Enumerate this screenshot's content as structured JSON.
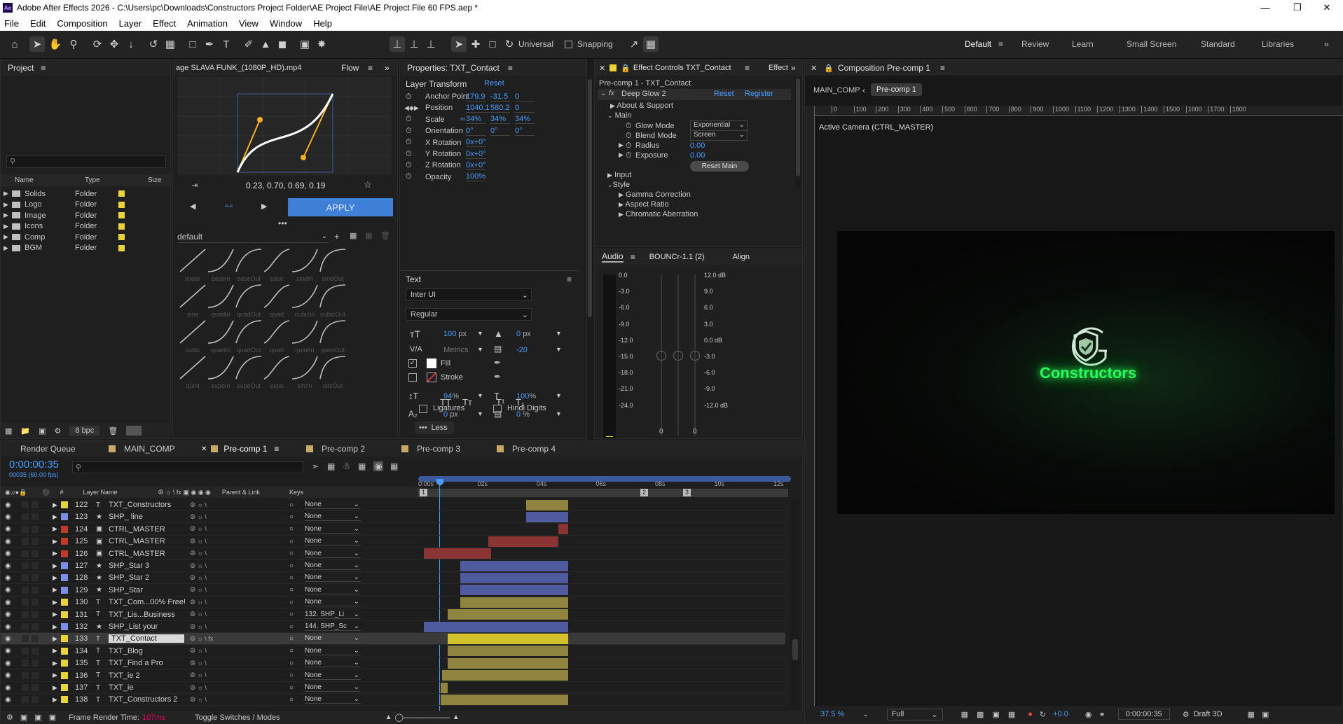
{
  "window": {
    "title": "Adobe After Effects 2026 - C:\\Users\\pc\\Downloads\\Constructors Project Folder\\AE Project File\\AE Project File 60 FPS.aep *",
    "app_icon": "Ae"
  },
  "menu": [
    "File",
    "Edit",
    "Composition",
    "Layer",
    "Effect",
    "Animation",
    "View",
    "Window",
    "Help"
  ],
  "toolbar": {
    "universal_label": "Universal",
    "snapping_label": "Snapping"
  },
  "workspaces": {
    "items": [
      "Default",
      "Review",
      "Learn",
      "Small Screen",
      "Standard",
      "Libraries"
    ],
    "active": "Default"
  },
  "project": {
    "title": "Project",
    "search_placeholder": "",
    "columns": {
      "name": "Name",
      "type": "Type",
      "size": "Size"
    },
    "items": [
      {
        "name": "Solids",
        "type": "Folder"
      },
      {
        "name": "Logo",
        "type": "Folder"
      },
      {
        "name": "Image",
        "type": "Folder"
      },
      {
        "name": "Icons",
        "type": "Folder"
      },
      {
        "name": "Comp",
        "type": "Folder"
      },
      {
        "name": "BGM",
        "type": "Folder"
      }
    ],
    "bpc": "8 bpc",
    "folder_color": "#e8d33b"
  },
  "flow": {
    "tab_label": "age SLAVA FUNK_(1080P_HD).mp4",
    "title": "Flow",
    "bezier": "0.23, 0.70, 0.69, 0.19",
    "apply": "APPLY",
    "preset": "default",
    "easings": [
      "linear",
      "easeIn",
      "easeOut",
      "ease",
      "sineIn",
      "sineOut",
      "sine",
      "quadIn",
      "quadOut",
      "quad",
      "cubicIn",
      "cubicOut",
      "cubic",
      "quartIn",
      "quartOut",
      "quart",
      "quintIn",
      "quintOut",
      "quint",
      "expoIn",
      "expoOut",
      "expo",
      "circIn",
      "circOut"
    ]
  },
  "properties": {
    "title": "Properties: TXT_Contact",
    "layer_transform": "Layer Transform",
    "reset": "Reset",
    "rows": [
      {
        "label": "Anchor Point",
        "values": [
          "179.9",
          "-31.5",
          "0"
        ]
      },
      {
        "label": "Position",
        "values": [
          "1040.1",
          "580.2",
          "0"
        ]
      },
      {
        "label": "Scale",
        "values": [
          "34%",
          "34%",
          "34%"
        ]
      },
      {
        "label": "Orientation",
        "values": [
          "0°",
          "0°",
          "0°"
        ]
      },
      {
        "label": "X Rotation",
        "values": [
          "0x+0°"
        ]
      },
      {
        "label": "Y Rotation",
        "values": [
          "0x+0°"
        ]
      },
      {
        "label": "Z Rotation",
        "values": [
          "0x+0°"
        ]
      },
      {
        "label": "Opacity",
        "values": [
          "100%"
        ]
      }
    ],
    "text": {
      "section": "Text",
      "font": "Inter UI",
      "style": "Regular",
      "size": "100",
      "size_unit": "px",
      "leading": "0",
      "leading_unit": "px",
      "kerning": "Metrics",
      "tracking": "-20",
      "fill": "Fill",
      "stroke": "Stroke",
      "vscale": "94",
      "hscale": "100",
      "baseline": "0",
      "baseline_unit": "px",
      "tsume": "0",
      "tsume_unit": "%",
      "pct": "%",
      "ligatures": "Ligatures",
      "hindi_digits": "Hindi Digits",
      "less": "Less"
    }
  },
  "effect_controls": {
    "title": "Effect Controls TXT_Contact",
    "tab2": "Effect",
    "breadcrumb": "Pre-comp 1 - TXT_Contact",
    "effect_name": "Deep Glow 2",
    "reset": "Reset",
    "register": "Register",
    "about": "About & Support",
    "main": "Main",
    "glow_mode_label": "Glow Mode",
    "glow_mode_value": "Exponential",
    "blend_mode_label": "Blend Mode",
    "blend_mode_value": "Screen",
    "radius_label": "Radius",
    "radius_value": "0.00",
    "exposure_label": "Exposure",
    "exposure_value": "0.00",
    "reset_main": "Reset Main",
    "input": "Input",
    "style": "Style",
    "gamma": "Gamma Correction",
    "aspect": "Aspect Ratio",
    "chromatic": "Chromatic Aberration"
  },
  "audio": {
    "tabs": [
      "Audio",
      "BOUNCr-1.1 (2)",
      "Align"
    ],
    "left_scale": [
      "0.0",
      "-3.0",
      "-6.0",
      "-9.0",
      "-12.0",
      "-15.0",
      "-18.0",
      "-21.0",
      "-24.0"
    ],
    "right_scale": [
      "12.0 dB",
      "9.0",
      "6.0",
      "3.0",
      "0.0 dB",
      "-3.0",
      "-6.0",
      "-9.0",
      "-12.0 dB"
    ],
    "bottom": [
      "0",
      "0"
    ]
  },
  "composition": {
    "title": "Composition Pre-comp 1",
    "breadcrumbs": [
      "MAIN_COMP",
      "Pre-comp 1"
    ],
    "ruler": [
      "0",
      "100",
      "200",
      "300",
      "400",
      "500",
      "600",
      "700",
      "800",
      "900",
      "1000",
      "1100",
      "1200",
      "1300",
      "1400",
      "1500",
      "1600",
      "1700",
      "1800"
    ],
    "camera": "Active Camera (CTRL_MASTER)",
    "logo_text": "Constructors",
    "glow_color": "#2bff5a",
    "zoom": "37.5 %",
    "quality": "Full",
    "exposure": "+0.0",
    "timecode": "0:00:00:35",
    "renderer": "Draft 3D"
  },
  "timeline": {
    "tabs": [
      "Render Queue",
      "MAIN_COMP",
      "Pre-comp 1",
      "Pre-comp 2",
      "Pre-comp 3",
      "Pre-comp 4"
    ],
    "active_tab": "Pre-comp 1",
    "timecode": "0:00:00:35",
    "frame_info": "00035 (60.00 fps)",
    "columns": {
      "layer_name": "Layer Name",
      "parent": "Parent & Link",
      "keys": "Keys",
      "num": "#"
    },
    "ruler": [
      "0:00s",
      "02s",
      "04s",
      "06s",
      "08s",
      "10s",
      "12s"
    ],
    "markers": [
      "1",
      "2",
      "3"
    ],
    "layers": [
      {
        "num": "122",
        "type": "T",
        "name": "TXT_Constructors",
        "parent": "None",
        "label": "#e8d33b"
      },
      {
        "num": "123",
        "type": "★",
        "name": "SHP_ line",
        "parent": "None",
        "label": "#7b8ee8"
      },
      {
        "num": "124",
        "type": "cam",
        "name": "CTRL_MASTER",
        "parent": "None",
        "label": "#c0392b"
      },
      {
        "num": "125",
        "type": "cam",
        "name": "CTRL_MASTER",
        "parent": "None",
        "label": "#c0392b"
      },
      {
        "num": "126",
        "type": "cam",
        "name": "CTRL_MASTER",
        "parent": "None",
        "label": "#c0392b"
      },
      {
        "num": "127",
        "type": "★",
        "name": "SHP_Star 3",
        "parent": "None",
        "label": "#7b8ee8"
      },
      {
        "num": "128",
        "type": "★",
        "name": "SHP_Star 2",
        "parent": "None",
        "label": "#7b8ee8"
      },
      {
        "num": "129",
        "type": "★",
        "name": "SHP_Star",
        "parent": "None",
        "label": "#7b8ee8"
      },
      {
        "num": "130",
        "type": "T",
        "name": "TXT_Com...00% Free!",
        "parent": "None",
        "label": "#e8d33b"
      },
      {
        "num": "131",
        "type": "T",
        "name": "TXT_Lis...Business",
        "parent": "132. SHP_Li",
        "label": "#e8d33b"
      },
      {
        "num": "132",
        "type": "★",
        "name": "SHP_List your",
        "parent": "144. SHP_Sc",
        "label": "#7b8ee8"
      },
      {
        "num": "133",
        "type": "T",
        "name": "TXT_Contact",
        "parent": "None",
        "label": "#e8d33b"
      },
      {
        "num": "134",
        "type": "T",
        "name": "TXT_Blog",
        "parent": "None",
        "label": "#e8d33b"
      },
      {
        "num": "135",
        "type": "T",
        "name": "TXT_Find a Pro",
        "parent": "None",
        "label": "#e8d33b"
      },
      {
        "num": "136",
        "type": "T",
        "name": "TXT_ie 2",
        "parent": "None",
        "label": "#e8d33b"
      },
      {
        "num": "137",
        "type": "T",
        "name": "TXT_ie",
        "parent": "None",
        "label": "#e8d33b"
      },
      {
        "num": "138",
        "type": "T",
        "name": "TXT_Constructors 2",
        "parent": "None",
        "label": "#e8d33b"
      }
    ],
    "selected_layer": "133",
    "footer": {
      "frame_render_label": "Frame Render Time:",
      "frame_render_value": "107ms",
      "toggle": "Toggle Switches / Modes"
    }
  }
}
